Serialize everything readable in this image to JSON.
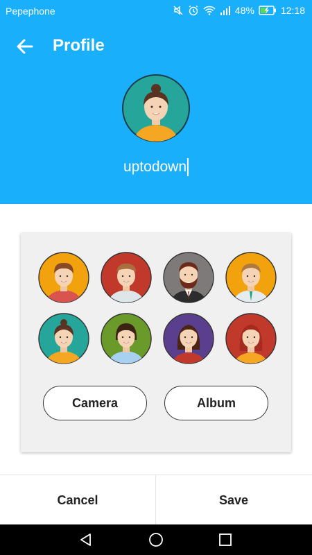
{
  "status_bar": {
    "carrier": "Pepephone",
    "battery": "48%",
    "time": "12:18",
    "icons": [
      "mute-icon",
      "alarm-icon",
      "wifi-icon",
      "signal-icon",
      "battery-icon"
    ]
  },
  "header": {
    "back_icon": "back-arrow-icon",
    "title": "Profile",
    "username": "uptodown",
    "background": "#1aaffa"
  },
  "avatar_picker": {
    "avatars": [
      {
        "name": "avatar-boy-orange-bg",
        "bg": "#f2a20c"
      },
      {
        "name": "avatar-man-red-bg",
        "bg": "#c0392b"
      },
      {
        "name": "avatar-bearded-man-gray-bg",
        "bg": "#7f7a7a"
      },
      {
        "name": "avatar-man-tie-orange-bg",
        "bg": "#f2a20c"
      },
      {
        "name": "avatar-girl-bun-teal-bg",
        "bg": "#26a69a"
      },
      {
        "name": "avatar-girl-green-bg",
        "bg": "#6a9a2a"
      },
      {
        "name": "avatar-woman-purple-bg",
        "bg": "#5b3f8f"
      },
      {
        "name": "avatar-redhead-woman-red-bg",
        "bg": "#c0392b"
      }
    ],
    "camera_label": "Camera",
    "album_label": "Album"
  },
  "actions": {
    "cancel_label": "Cancel",
    "save_label": "Save"
  },
  "nav_bar": {
    "icons": [
      "nav-back-icon",
      "nav-home-icon",
      "nav-recents-icon"
    ]
  }
}
